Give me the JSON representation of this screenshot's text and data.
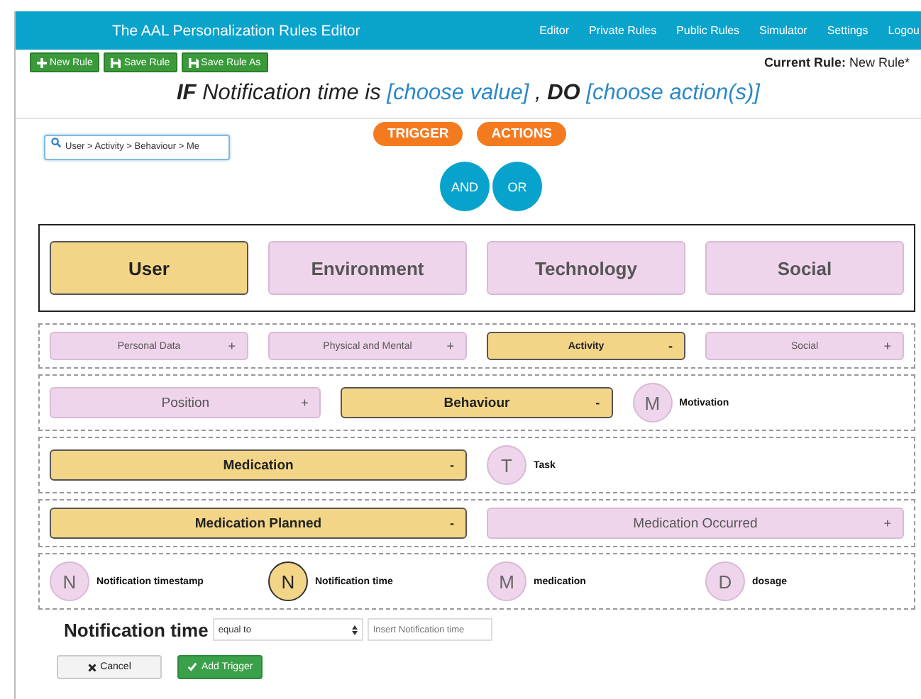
{
  "navbar": {
    "title": "The AAL Personalization Rules Editor",
    "links": [
      "Editor",
      "Private Rules",
      "Public Rules",
      "Simulator",
      "Settings",
      "Logou"
    ]
  },
  "toolbar": {
    "buttons": [
      "New Rule",
      "Save Rule",
      "Save Rule As"
    ],
    "current_rule_label": "Current Rule:",
    "current_rule_value": "New Rule*"
  },
  "rule_sentence": [
    {
      "kind": "keyword",
      "text": "IF"
    },
    {
      "kind": "text",
      "text": "Notification time is"
    },
    {
      "kind": "link",
      "text": "[choose value]"
    },
    {
      "kind": "text",
      "text": ","
    },
    {
      "kind": "keyword",
      "text": "DO"
    },
    {
      "kind": "link",
      "text": "[choose action(s)]"
    }
  ],
  "search": {
    "value": "User > Activity > Behaviour > Me"
  },
  "mode_buttons": [
    "TRIGGER",
    "ACTIONS"
  ],
  "operators": [
    "AND",
    "OR"
  ],
  "category_rows": [
    {
      "kind": "main",
      "items": [
        {
          "kind": "category",
          "label": "User",
          "selected": true
        },
        {
          "kind": "category",
          "label": "Environment",
          "selected": false
        },
        {
          "kind": "category",
          "label": "Technology",
          "selected": false
        },
        {
          "kind": "category",
          "label": "Social",
          "selected": false
        }
      ]
    },
    {
      "kind": "small",
      "items": [
        {
          "kind": "category",
          "label": "Personal Data",
          "sign": "+",
          "selected": false
        },
        {
          "kind": "category",
          "label": "Physical and Mental",
          "sign": "+",
          "selected": false
        },
        {
          "kind": "category",
          "label": "Activity",
          "sign": "-",
          "selected": true
        },
        {
          "kind": "category",
          "label": "Social",
          "sign": "+",
          "selected": false
        }
      ]
    },
    {
      "kind": "medium",
      "items": [
        {
          "kind": "category",
          "label": "Position",
          "sign": "+",
          "selected": false
        },
        {
          "kind": "category",
          "label": "Behaviour",
          "sign": "-",
          "selected": true
        },
        {
          "kind": "leaf",
          "letter": "M",
          "label": "Motivation",
          "selected": false
        }
      ]
    },
    {
      "kind": "medium",
      "items": [
        {
          "kind": "category",
          "label": "Medication",
          "sign": "-",
          "selected": true
        },
        {
          "kind": "leaf",
          "letter": "T",
          "label": "Task",
          "selected": false
        }
      ]
    },
    {
      "kind": "medium",
      "items": [
        {
          "kind": "category",
          "label": "Medication Planned",
          "sign": "-",
          "selected": true
        },
        {
          "kind": "category",
          "label": "Medication Occurred",
          "sign": "+",
          "selected": false
        }
      ]
    },
    {
      "kind": "medium",
      "items": [
        {
          "kind": "leaf",
          "letter": "N",
          "label": "Notification timestamp",
          "selected": false
        },
        {
          "kind": "leaf",
          "letter": "N",
          "label": "Notification time",
          "selected": true
        },
        {
          "kind": "leaf",
          "letter": "M",
          "label": "medication",
          "selected": false
        },
        {
          "kind": "leaf",
          "letter": "D",
          "label": "dosage",
          "selected": false
        }
      ]
    }
  ],
  "condition": {
    "label": "Notification time",
    "operator": "equal to",
    "placeholder": "Insert Notification time"
  },
  "actions": [
    {
      "kind": "cancel",
      "label": "Cancel"
    },
    {
      "kind": "add",
      "label": "Add Trigger"
    }
  ]
}
